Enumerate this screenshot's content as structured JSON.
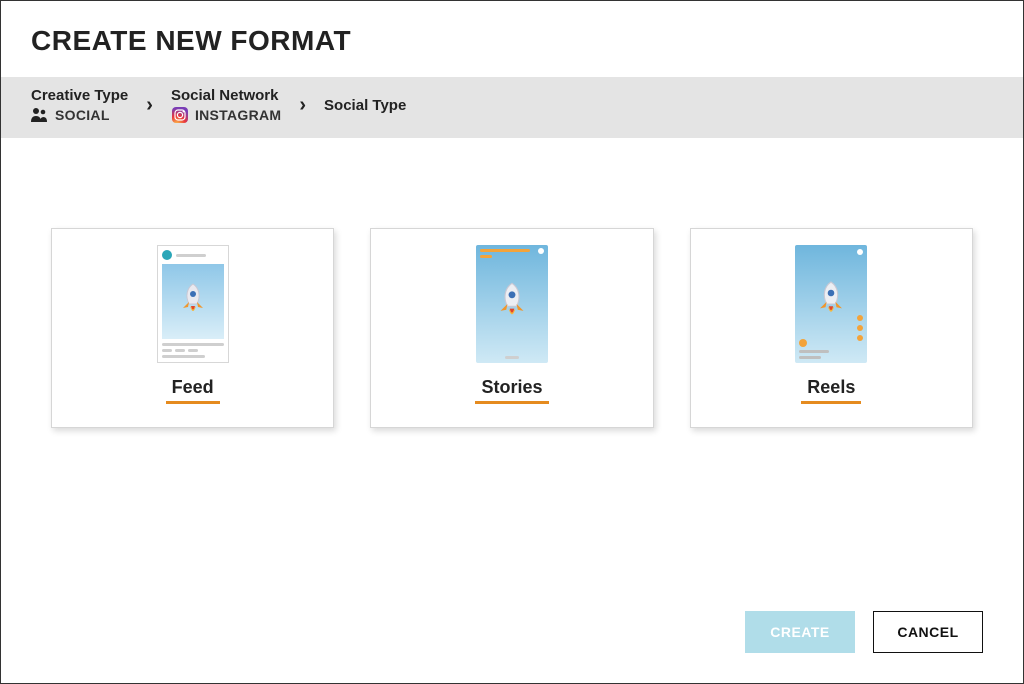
{
  "title": "CREATE NEW FORMAT",
  "breadcrumb": {
    "items": [
      {
        "label": "Creative Type",
        "value": "SOCIAL",
        "icon": "people-icon"
      },
      {
        "label": "Social Network",
        "value": "INSTAGRAM",
        "icon": "instagram-icon"
      },
      {
        "label": "Social Type",
        "value": "",
        "icon": ""
      }
    ]
  },
  "options": [
    {
      "label": "Feed"
    },
    {
      "label": "Stories"
    },
    {
      "label": "Reels"
    }
  ],
  "buttons": {
    "create": "CREATE",
    "cancel": "CANCEL"
  },
  "colors": {
    "accent_orange": "#e58b1f",
    "breadcrumb_bg": "#e4e4e4",
    "create_btn": "#b0dde9"
  }
}
